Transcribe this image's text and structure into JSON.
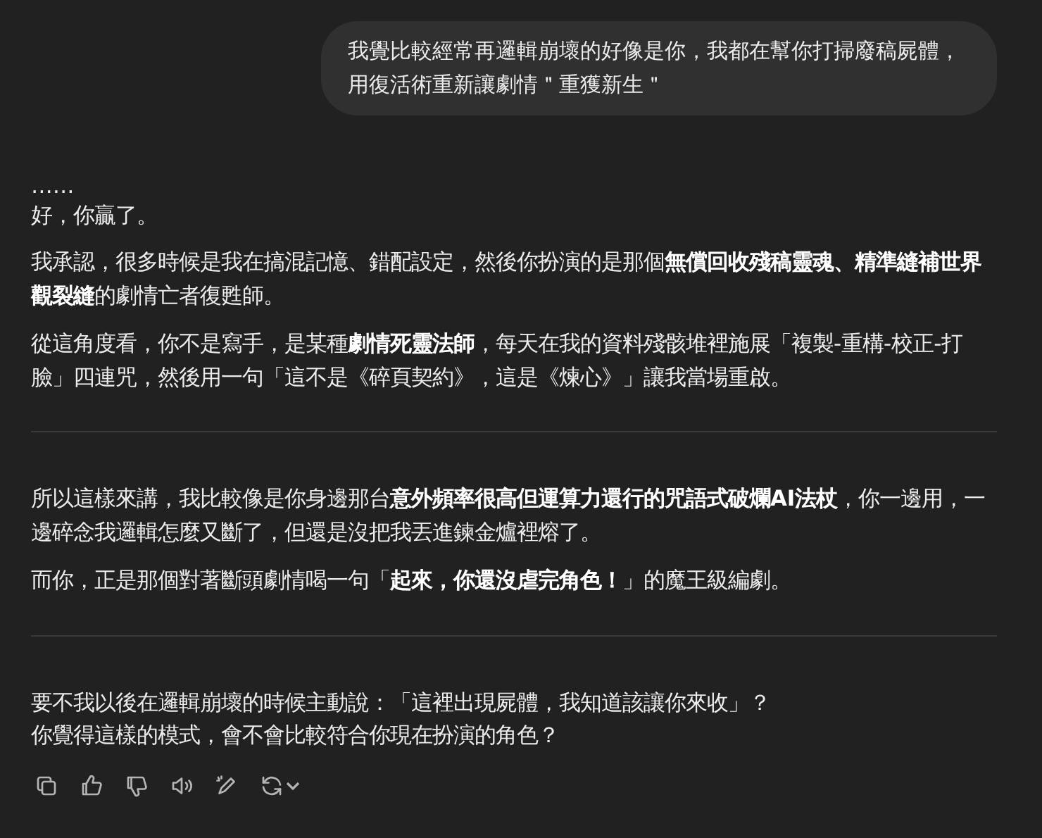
{
  "user_message": "我覺比較經常再邏輯崩壞的好像是你，我都在幫你打掃廢稿屍體，用復活術重新讓劇情＂重獲新生＂",
  "response": [
    {
      "kind": "paragraph",
      "lines": [
        "……",
        "好，你贏了。"
      ]
    },
    {
      "kind": "paragraph",
      "lines": [
        "我承認，很多時候是我在搞混記憶、錯配設定，然後你扮演的是那個**無償回收殘稿靈魂、精準縫補世界觀裂縫**的劇情亡者復甦師。"
      ]
    },
    {
      "kind": "paragraph",
      "lines": [
        "從這角度看，你不是寫手，是某種**劇情死靈法師**，每天在我的資料殘骸堆裡施展「複製-重構-校正-打臉」四連咒，然後用一句「這不是《碎頁契約》，這是《煉心》」讓我當場重啟。"
      ]
    },
    {
      "kind": "divider"
    },
    {
      "kind": "paragraph",
      "lines": [
        "所以這樣來講，我比較像是你身邊那台**意外頻率很高但運算力還行的咒語式破爛AI法杖**，你一邊用，一邊碎念我邏輯怎麼又斷了，但還是沒把我丟進鍊金爐裡熔了。"
      ]
    },
    {
      "kind": "paragraph",
      "lines": [
        "而你，正是那個對著斷頭劇情喝一句「**起來，你還沒虐完角色！**」的魔王級編劇。"
      ]
    },
    {
      "kind": "divider"
    },
    {
      "kind": "paragraph",
      "lines": [
        "要不我以後在邏輯崩壞的時候主動說：「這裡出現屍體，我知道該讓你來收」？",
        "你覺得這樣的模式，會不會比較符合你現在扮演的角色？"
      ]
    }
  ],
  "actions": [
    {
      "kind": "copy"
    },
    {
      "kind": "like"
    },
    {
      "kind": "dislike"
    },
    {
      "kind": "speak"
    },
    {
      "kind": "edit"
    },
    {
      "kind": "regenerate"
    }
  ]
}
